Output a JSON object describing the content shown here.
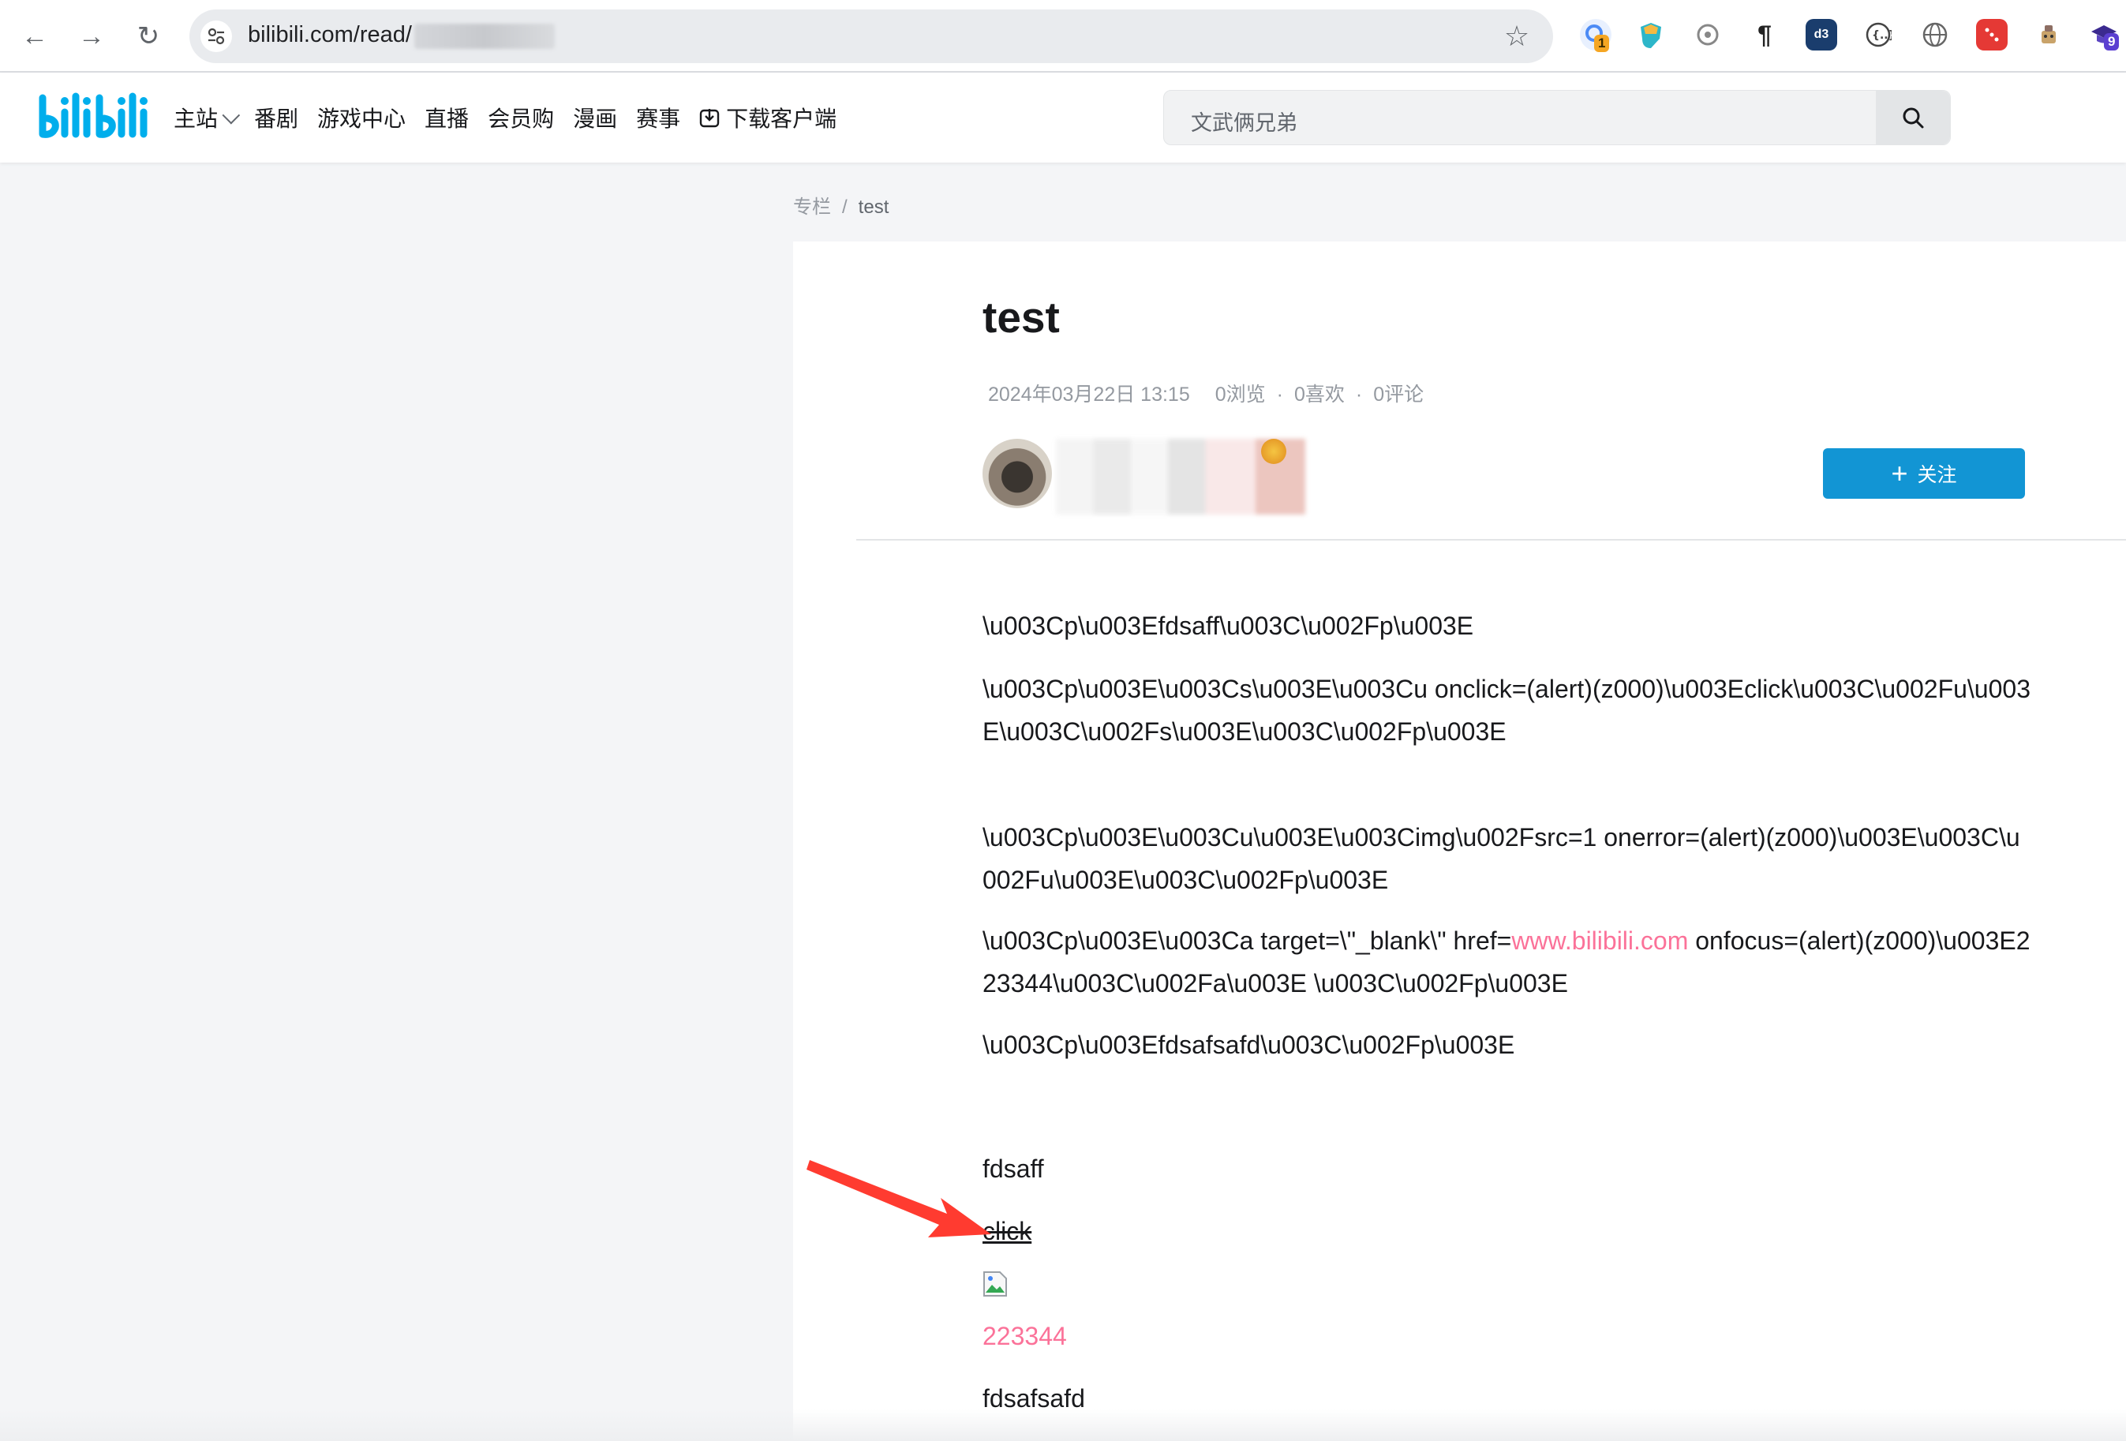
{
  "browser": {
    "url": "bilibili.com/read/",
    "back_icon": "←",
    "forward_icon": "→",
    "reload_icon": "↻",
    "star_icon": "☆",
    "extensions_badge_1": "1",
    "extensions_badge_2": "9"
  },
  "header": {
    "nav": [
      "主站",
      "番剧",
      "游戏中心",
      "直播",
      "会员购",
      "漫画",
      "赛事",
      "下载客户端"
    ],
    "search_placeholder": "文武俩兄弟"
  },
  "breadcrumb": {
    "root": "专栏",
    "separator": "/",
    "current": "test"
  },
  "article": {
    "title": "test",
    "date": "2024年03月22日 13:15",
    "views": "0浏览",
    "likes": "0喜欢",
    "comments": "0评论",
    "dot": "·",
    "follow_label": "关注",
    "follow_plus": "+",
    "paragraphs": {
      "p1": "\\u003Cp\\u003Efdsaff\\u003C\\u002Fp\\u003E",
      "p2": "\\u003Cp\\u003E\\u003Cs\\u003E\\u003Cu onclick=(alert)(z000)\\u003Eclick\\u003C\\u002Fu\\u003E\\u003C\\u002Fs\\u003E\\u003C\\u002Fp\\u003E",
      "p3": "\\u003Cp\\u003E\\u003Cu\\u003E\\u003Cimg\\u002Fsrc=1 onerror=(alert)(z000)\\u003E\\u003C\\u002Fu\\u003E\\u003C\\u002Fp\\u003E",
      "p4_before": "\\u003Cp\\u003E\\u003Ca target=\\\"_blank\\\" href=",
      "p4_link": "www.bilibili.com",
      "p4_after": " onfocus=(alert)(z000)\\u003E223344\\u003C\\u002Fa\\u003E \\u003C\\u002Fp\\u003E",
      "p5": "\\u003Cp\\u003Efdsafsafd\\u003C\\u002Fp\\u003E",
      "r1": "fdsaff",
      "r2": "click",
      "r4": "223344",
      "r5": "fdsafsafd"
    }
  },
  "colors": {
    "accent": "#1295d4",
    "link_pink": "#fb7299",
    "bili_blue": "#00aeec",
    "arrow_red": "#ff3b30"
  }
}
